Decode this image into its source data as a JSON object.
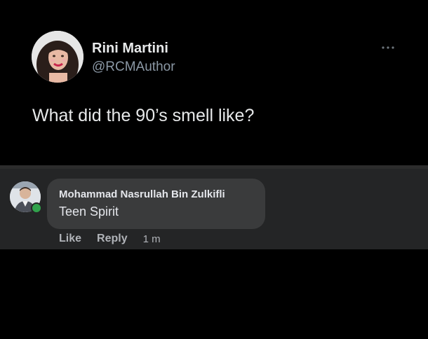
{
  "tweet": {
    "author_name": "Rini Martini",
    "author_handle": "@RCMAuthor",
    "text": "What did the 90’s smell like?",
    "more_icon": "more-horizontal-icon"
  },
  "comment": {
    "commenter_name": "Mohammad Nasrullah Bin Zulkifli",
    "text": "Teen Spirit",
    "online_status_color": "#31a24c",
    "actions": {
      "like_label": "Like",
      "reply_label": "Reply",
      "timestamp": "1 m"
    }
  },
  "colors": {
    "tweet_background": "#000000",
    "comment_background": "#242526",
    "bubble_background": "#3a3b3c"
  }
}
